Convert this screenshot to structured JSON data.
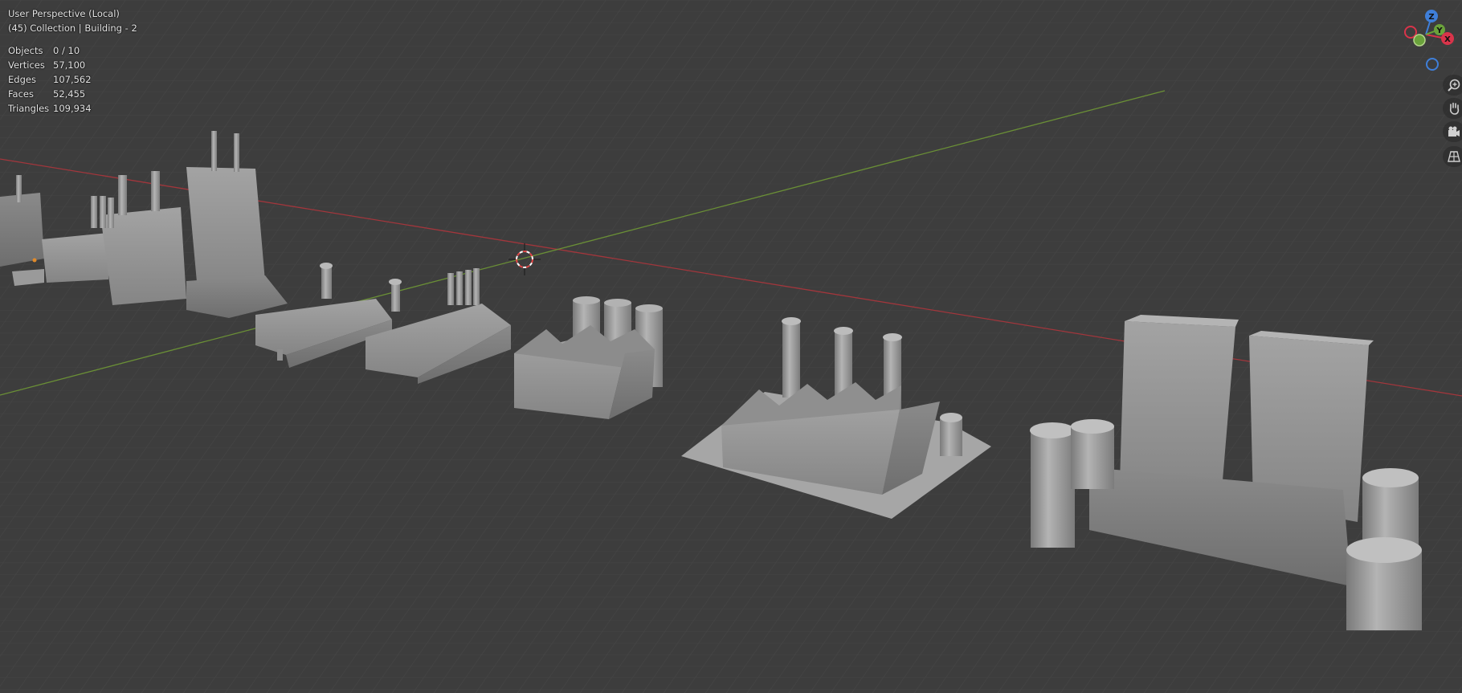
{
  "viewport": {
    "view_name": "User Perspective (Local)",
    "collection_line": "(45) Collection | Building - 2"
  },
  "stats": [
    {
      "label": "Objects",
      "value": "0 / 10"
    },
    {
      "label": "Vertices",
      "value": "57,100"
    },
    {
      "label": "Edges",
      "value": "107,562"
    },
    {
      "label": "Faces",
      "value": "52,455"
    },
    {
      "label": "Triangles",
      "value": "109,934"
    }
  ],
  "gizmo": {
    "z_label": "Z",
    "y_label": "Y",
    "x_label": "X",
    "colors": {
      "x": "#d9344a",
      "y": "#6aa23b",
      "z": "#3f7fd9"
    }
  },
  "nav_buttons": [
    {
      "name": "zoom-button",
      "icon": "zoom-icon"
    },
    {
      "name": "pan-button",
      "icon": "hand-icon"
    },
    {
      "name": "camera-view-button",
      "icon": "camera-icon"
    },
    {
      "name": "perspective-toggle-button",
      "icon": "grid-icon"
    }
  ],
  "colors": {
    "background": "#3d3d3d",
    "grid_line": "#474747",
    "x_axis": "#a2363c",
    "y_axis": "#6a8f36",
    "model": "#8f8f8f"
  }
}
